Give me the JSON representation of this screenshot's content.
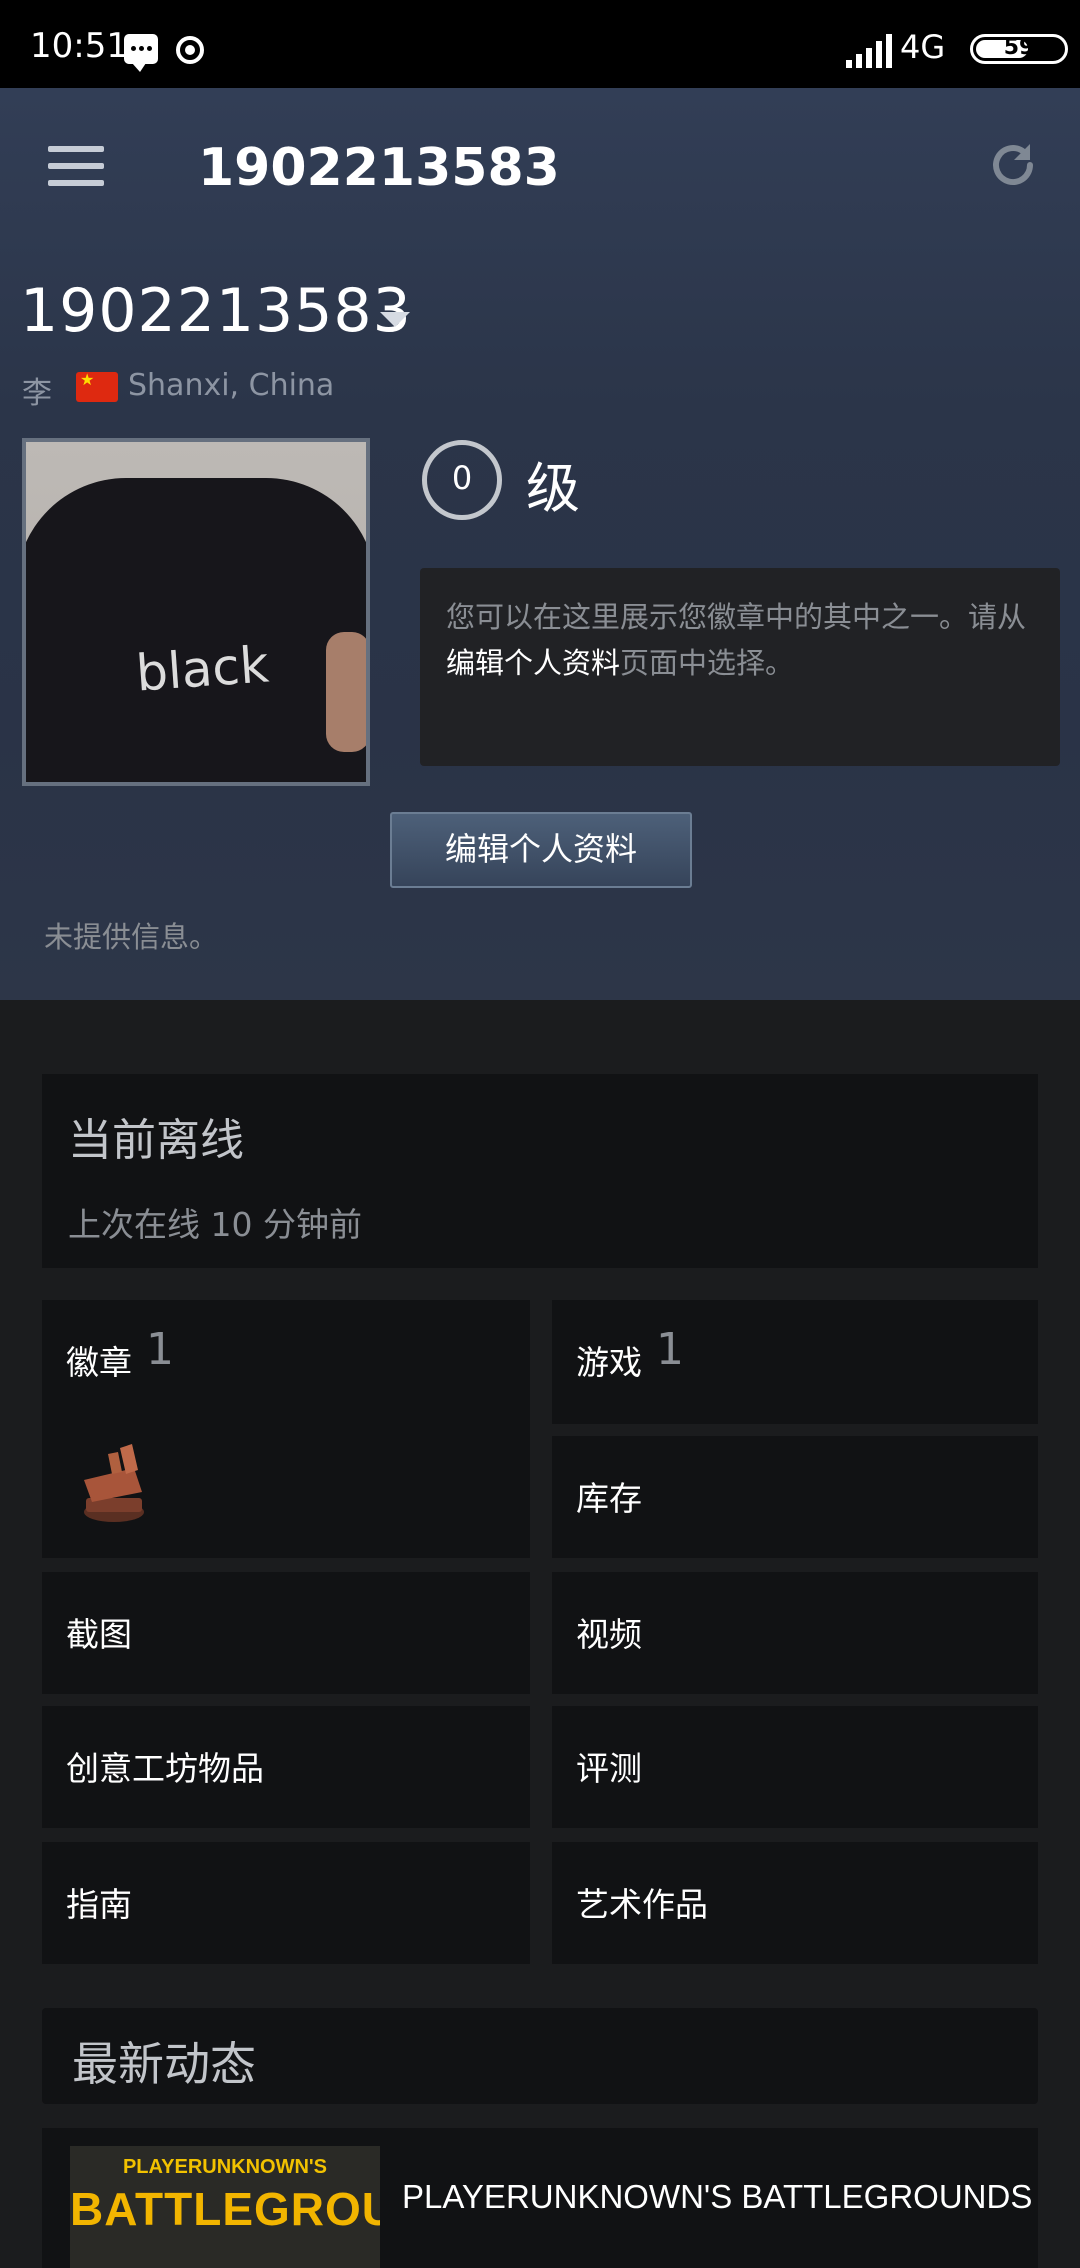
{
  "status_bar": {
    "time": "10:51",
    "network": "4G",
    "battery": "59"
  },
  "header": {
    "title": "1902213583"
  },
  "profile": {
    "persona_name": "1902213583",
    "real_name": "李",
    "location": "Shanxi, China",
    "avatar_text": "black",
    "level_number": "0",
    "level_label": "级",
    "badge_hint_prefix": "您可以在这里展示您徽章中的其中之一。请从",
    "badge_hint_link": "编辑个人资料",
    "badge_hint_suffix": "页面中选择。",
    "edit_button": "编辑个人资料",
    "no_info": "未提供信息。"
  },
  "status": {
    "title": "当前离线",
    "last_online": "上次在线 10 分钟前"
  },
  "tiles": {
    "badges": {
      "label": "徽章",
      "count": "1"
    },
    "games": {
      "label": "游戏",
      "count": "1"
    },
    "inventory": "库存",
    "screenshots": "截图",
    "videos": "视频",
    "workshop": "创意工坊物品",
    "reviews": "评测",
    "guides": "指南",
    "artwork": "艺术作品"
  },
  "recent": {
    "title": "最新动态",
    "game_art_line1": "PLAYERUNKNOWN'S",
    "game_art_line2": "BATTLEGROUNDS",
    "game_name": "PLAYERUNKNOWN'S BATTLEGROUNDS"
  }
}
